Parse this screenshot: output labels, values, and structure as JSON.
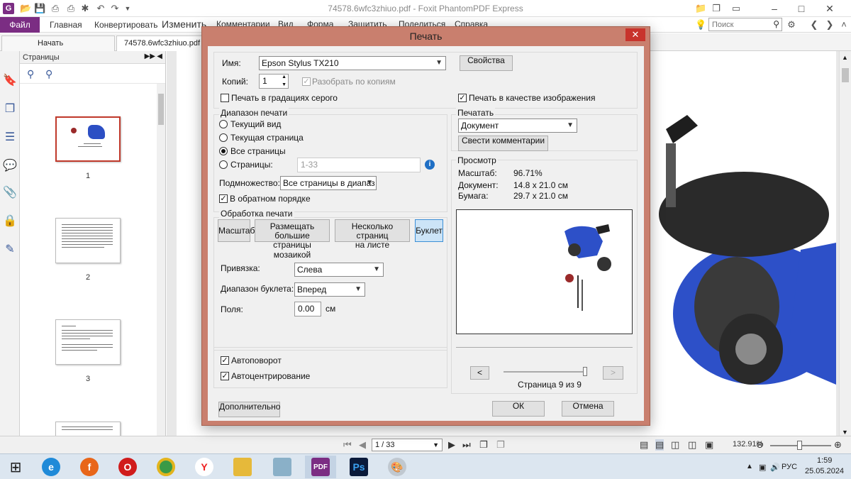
{
  "window": {
    "title": "74578.6wfc3zhiuo.pdf - Foxit PhantomPDF Express"
  },
  "ribbon": {
    "file": "Файл",
    "tabs": [
      "Главная",
      "Конвертировать",
      "Изменить",
      "Комментарии",
      "Вид",
      "Форма",
      "Защитить",
      "Поделиться",
      "Справка"
    ],
    "search_placeholder": "Поиск"
  },
  "doc_tabs": [
    "Начать",
    "74578.6wfc3zhiuo.pdf"
  ],
  "pages_panel": {
    "title": "Страницы",
    "thumbnails": [
      "1",
      "2",
      "3"
    ]
  },
  "statusbar": {
    "page_indicator": "1 / 33",
    "zoom": "132.91%"
  },
  "taskbar": {
    "language": "РУС",
    "time": "1:59",
    "date": "25.05.2024"
  },
  "print_dialog": {
    "title": "Печать",
    "printer": {
      "name_label": "Имя:",
      "name_value": "Epson Stylus TX210",
      "properties_button": "Свойства",
      "copies_label": "Копий:",
      "copies_value": "1",
      "collate_label": "Разобрать по копиям",
      "grayscale_label": "Печать в градациях серого",
      "as_image_label": "Печать в качестве изображения"
    },
    "range": {
      "legend": "Диапазон печати",
      "current_view": "Текущий вид",
      "current_page": "Текущая страница",
      "all_pages": "Все страницы",
      "pages_label": "Страницы:",
      "pages_value": "1-33",
      "subset_label": "Подмножество:",
      "subset_value": "Все страницы в диапаз",
      "reverse_label": "В обратном порядке"
    },
    "handling": {
      "legend": "Обработка печати",
      "scale_button": "Масштаб",
      "tile_button_1": "Размещать большие",
      "tile_button_2": "страницы мозаикой",
      "multiple_button_1": "Несколько страниц",
      "multiple_button_2": "на листе",
      "booklet_button": "Буклет",
      "binding_label": "Привязка:",
      "binding_value": "Слева",
      "booklet_range_label": "Диапазон буклета:",
      "booklet_range_value": "Вперед",
      "margin_label": "Поля:",
      "margin_value": "0.00",
      "margin_unit": "см"
    },
    "options": {
      "autorotate": "Автоповорот",
      "autocenter": "Автоцентрирование"
    },
    "print_what": {
      "legend": "Печатать",
      "value": "Документ",
      "summarize_button": "Свести комментарии"
    },
    "preview": {
      "legend": "Просмотр",
      "scale_label": "Масштаб:",
      "scale_value": "96.71%",
      "document_label": "Документ:",
      "document_value": "14.8 x 21.0 см",
      "paper_label": "Бумага:",
      "paper_value": "29.7 x 21.0 см",
      "page_status": "Страница 9 из 9",
      "prev": "<",
      "next": ">"
    },
    "advanced_button": "Дополнительно",
    "ok_button": "ОК",
    "cancel_button": "Отмена"
  }
}
